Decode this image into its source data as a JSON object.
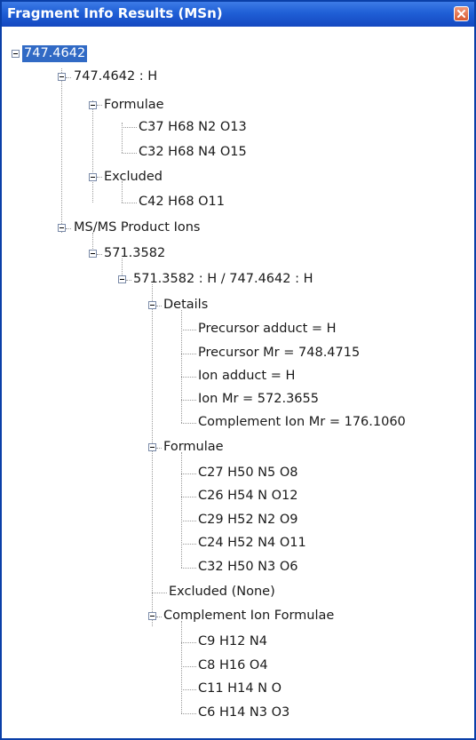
{
  "window": {
    "title": "Fragment Info Results (MSn)",
    "close_icon": "close-icon",
    "colors": {
      "titlebar": "#1f5fd6",
      "selection": "#316ac5",
      "close_button": "#d95a30"
    }
  },
  "tree": {
    "selected": "747.4642",
    "root": "747.4642",
    "n1": "747.4642 : H",
    "n1_formulae": "Formulae",
    "n1_formulae_items": [
      "C37 H68 N2 O13",
      "C32 H68 N4 O15"
    ],
    "n1_excluded": "Excluded",
    "n1_excluded_items": [
      "C42 H68 O11"
    ],
    "msms": "MS/MS Product Ions",
    "ion": "571.3582",
    "ion_detail": "571.3582 : H / 747.4642 : H",
    "details": "Details",
    "details_items": [
      "Precursor adduct = H",
      "Precursor Mr = 748.4715",
      "Ion adduct = H",
      "Ion Mr = 572.3655",
      "Complement Ion Mr = 176.1060"
    ],
    "formulae": "Formulae",
    "formulae_items": [
      "C27 H50 N5 O8",
      "C26 H54 N O12",
      "C29 H52 N2 O9",
      "C24 H52 N4 O11",
      "C32 H50 N3 O6"
    ],
    "excluded_none": "Excluded (None)",
    "complement": "Complement Ion Formulae",
    "complement_items": [
      "C9 H12 N4",
      "C8 H16 O4",
      "C11 H14 N O",
      "C6 H14 N3 O3"
    ]
  }
}
